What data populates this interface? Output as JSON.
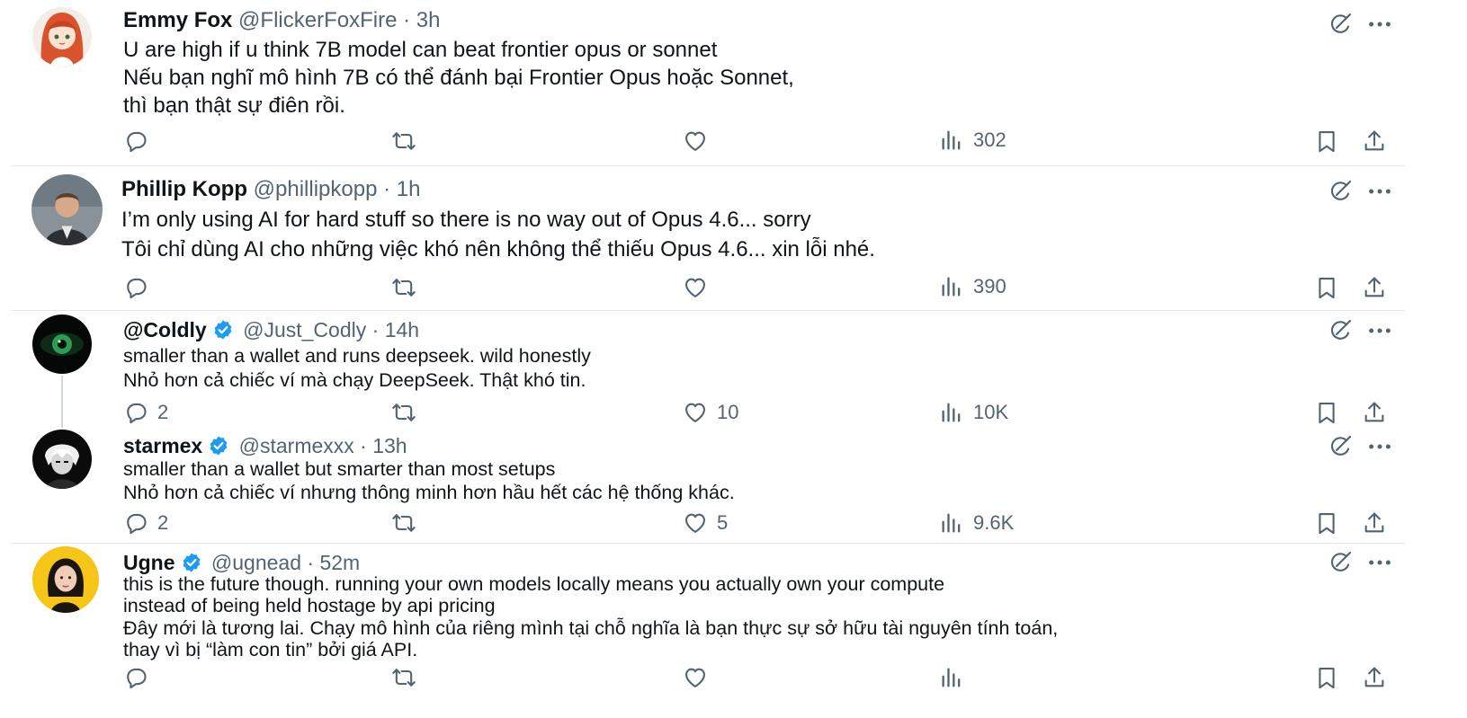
{
  "colors": {
    "text": "#0f1419",
    "muted": "#536471",
    "verified": "#1d9bf0",
    "divider": "#e4e8eb"
  },
  "icons": {
    "reply": "reply-icon",
    "repost": "repost-icon",
    "like": "like-icon",
    "views": "views-icon",
    "bookmark": "bookmark-icon",
    "share": "share-icon",
    "grok": "grok-icon",
    "more": "more-icon",
    "verified": "verified-badge-icon"
  },
  "tweets": [
    {
      "name": "Emmy Fox",
      "handle": "@FlickerFoxFire",
      "sep": "·",
      "time": "3h",
      "verified": false,
      "lines": [
        "U are high if u think 7B model can beat frontier opus or sonnet",
        "Nếu bạn nghĩ mô hình 7B có thể đánh bại Frontier Opus hoặc Sonnet,",
        "thì bạn thật sự điên rồi."
      ],
      "replies": "",
      "likes": "",
      "views": "302"
    },
    {
      "name": "Phillip Kopp",
      "handle": "@phillipkopp",
      "sep": "·",
      "time": "1h",
      "verified": false,
      "lines": [
        "I’m only using AI for hard stuff so there is no way out of Opus 4.6... sorry",
        "Tôi chỉ dùng AI cho những việc khó nên không thể thiếu Opus 4.6... xin lỗi nhé."
      ],
      "replies": "",
      "likes": "",
      "views": "390"
    },
    {
      "name": "@Coldly",
      "handle": "@Just_Codly",
      "sep": "·",
      "time": "14h",
      "verified": true,
      "lines": [
        "smaller than a wallet and runs deepseek. wild honestly",
        "Nhỏ hơn cả chiếc ví mà chạy DeepSeek. Thật khó tin."
      ],
      "replies": "2",
      "likes": "10",
      "views": "10K"
    },
    {
      "name": "starmex",
      "handle": "@starmexxx",
      "sep": "·",
      "time": "13h",
      "verified": true,
      "lines": [
        "smaller than a wallet but smarter than most setups",
        "Nhỏ hơn cả chiếc ví nhưng thông minh hơn hầu hết các hệ thống khác."
      ],
      "replies": "2",
      "likes": "5",
      "views": "9.6K"
    },
    {
      "name": "Ugne",
      "handle": "@ugnead",
      "sep": "·",
      "time": "52m",
      "verified": true,
      "lines": [
        "this is the future though. running your own models locally means you actually own your compute",
        "instead of being held hostage by api pricing",
        "Đây mới là tương lai. Chạy mô hình của riêng mình tại chỗ nghĩa là bạn thực sự sở hữu tài nguyên tính toán,",
        "thay vì bị “làm con tin” bởi giá API."
      ],
      "replies": "",
      "likes": "",
      "views": ""
    }
  ]
}
